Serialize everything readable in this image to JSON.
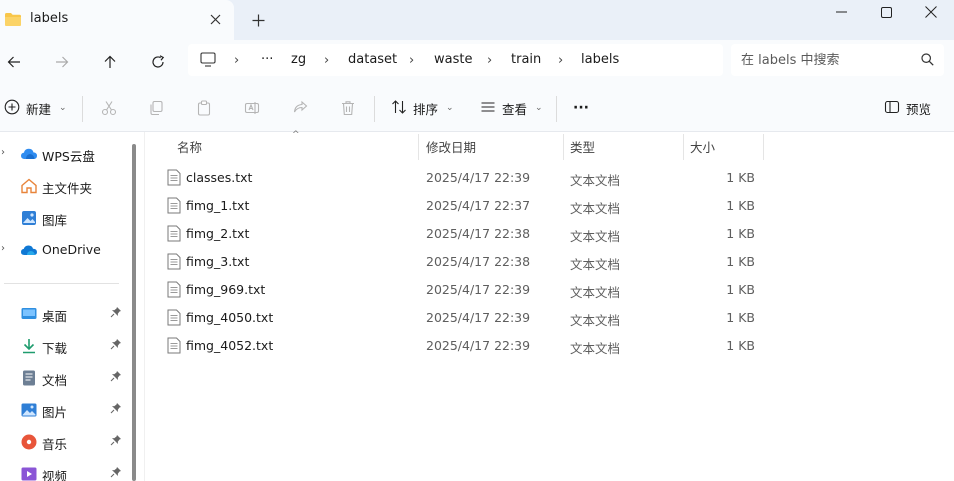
{
  "tab": {
    "title": "labels",
    "close_glyph": "✕",
    "new_glyph": "+"
  },
  "window": {
    "minimize_glyph": "—",
    "maximize_glyph": "□",
    "close_glyph": "✕"
  },
  "breadcrumb": {
    "overflow": "···",
    "items": [
      "zg",
      "dataset",
      "waste",
      "train",
      "labels"
    ],
    "separator": "›"
  },
  "search": {
    "placeholder": "在 labels 中搜索"
  },
  "toolbar": {
    "new_label": "新建",
    "sort_label": "排序",
    "view_label": "查看",
    "more_label": "···",
    "preview_label": "预览",
    "chevron": "⌄"
  },
  "sidebar": {
    "items": [
      {
        "label": "WPS云盘",
        "icon": "cloud-icon",
        "expandable": true
      },
      {
        "label": "主文件夹",
        "icon": "home-icon",
        "expandable": false
      },
      {
        "label": "图库",
        "icon": "gallery-icon",
        "expandable": false
      },
      {
        "label": "OneDrive",
        "icon": "onedrive-icon",
        "expandable": true
      }
    ],
    "pinned": [
      {
        "label": "桌面",
        "icon": "desktop-icon"
      },
      {
        "label": "下载",
        "icon": "download-icon"
      },
      {
        "label": "文档",
        "icon": "documents-icon"
      },
      {
        "label": "图片",
        "icon": "pictures-icon"
      },
      {
        "label": "音乐",
        "icon": "music-icon"
      },
      {
        "label": "视频",
        "icon": "videos-icon"
      }
    ]
  },
  "columns": {
    "name": "名称",
    "date": "修改日期",
    "type": "类型",
    "size": "大小"
  },
  "files": [
    {
      "name": "classes.txt",
      "date": "2025/4/17 22:39",
      "type": "文本文档",
      "size": "1 KB"
    },
    {
      "name": "fimg_1.txt",
      "date": "2025/4/17 22:37",
      "type": "文本文档",
      "size": "1 KB"
    },
    {
      "name": "fimg_2.txt",
      "date": "2025/4/17 22:38",
      "type": "文本文档",
      "size": "1 KB"
    },
    {
      "name": "fimg_3.txt",
      "date": "2025/4/17 22:38",
      "type": "文本文档",
      "size": "1 KB"
    },
    {
      "name": "fimg_969.txt",
      "date": "2025/4/17 22:39",
      "type": "文本文档",
      "size": "1 KB"
    },
    {
      "name": "fimg_4050.txt",
      "date": "2025/4/17 22:39",
      "type": "文本文档",
      "size": "1 KB"
    },
    {
      "name": "fimg_4052.txt",
      "date": "2025/4/17 22:39",
      "type": "文本文档",
      "size": "1 KB"
    }
  ],
  "colors": {
    "titlebar": "#eaf0f8",
    "toolbar": "#f9fbfd",
    "accent": "#0067c0",
    "folder": "#f8c64a"
  }
}
